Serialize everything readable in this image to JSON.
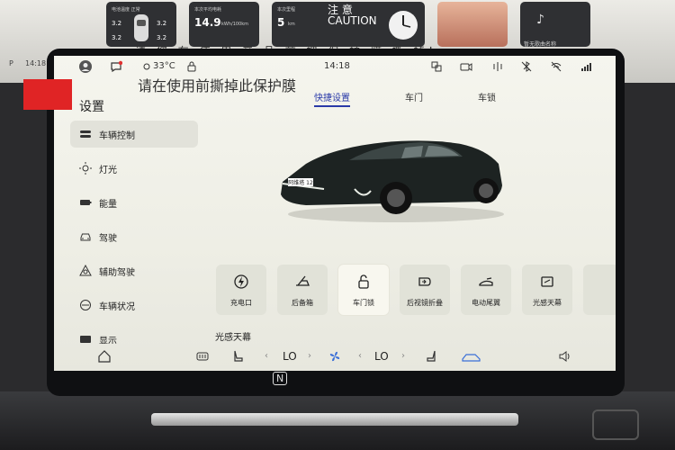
{
  "environment": {
    "cluster_cards": [
      {
        "title": "电池温度 正常",
        "values": [
          "3.2",
          "3.2",
          "3.2",
          "3.2"
        ]
      },
      {
        "title": "本次平均电耗",
        "value": "14.9",
        "unit": "kWh/100km"
      },
      {
        "title": "本次里程",
        "value": "5",
        "unit": "km"
      },
      {
        "title": "暂无歌曲名称"
      }
    ],
    "warning_title": "注 意",
    "warning_title_en": "CAUTION",
    "warning_strip": "请 您 在 使 用 产 品 前 把 保 护 膜 撕 掉！",
    "cluster_bar": {
      "gear": "P",
      "time": "14:18"
    },
    "nfc_label": "N"
  },
  "status_bar": {
    "temperature": "33°C",
    "time": "14:18",
    "protective_film_notice": "请在使用前撕掉此保护膜"
  },
  "sidebar": {
    "title": "设置",
    "items": [
      {
        "label": "车辆控制",
        "icon": "car-control-icon",
        "active": true
      },
      {
        "label": "灯光",
        "icon": "light-icon"
      },
      {
        "label": "能量",
        "icon": "battery-icon"
      },
      {
        "label": "驾驶",
        "icon": "car-front-icon"
      },
      {
        "label": "辅助驾驶",
        "icon": "assist-drive-icon"
      },
      {
        "label": "车辆状况",
        "icon": "vehicle-status-icon"
      },
      {
        "label": "显示",
        "icon": "display-icon"
      }
    ]
  },
  "tabs": [
    {
      "label": "快捷设置",
      "active": true
    },
    {
      "label": "车门"
    },
    {
      "label": "车锁"
    }
  ],
  "vehicle": {
    "plate_text": "阿维塔 12"
  },
  "quick_actions": [
    {
      "label": "充电口",
      "icon": "charge-port-icon"
    },
    {
      "label": "后备箱",
      "icon": "trunk-icon"
    },
    {
      "label": "车门锁",
      "icon": "door-lock-icon",
      "active": true
    },
    {
      "label": "后视镜折叠",
      "icon": "mirror-fold-icon"
    },
    {
      "label": "电动尾翼",
      "icon": "spoiler-icon"
    },
    {
      "label": "光感天幕",
      "icon": "sunroof-icon"
    }
  ],
  "quick_actions_caption": "光感天幕",
  "dock": {
    "left_temp": "LO",
    "right_temp": "LO",
    "chevron_left": "‹",
    "chevron_right": "›"
  },
  "colors": {
    "accent": "#2a3aa8",
    "red_tag": "#e02425",
    "notification": "#e03131"
  }
}
